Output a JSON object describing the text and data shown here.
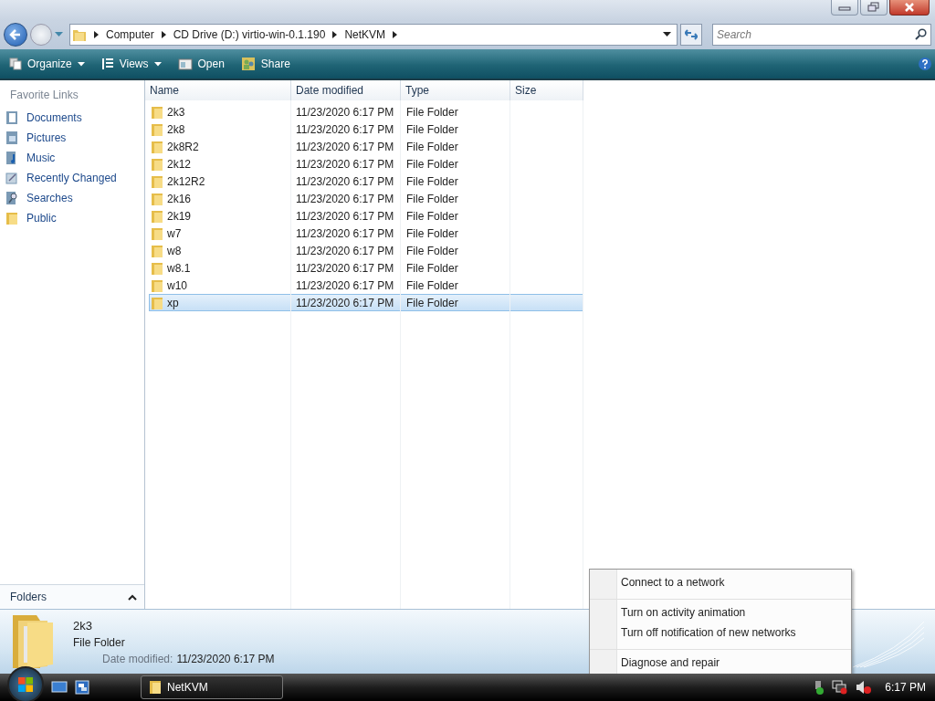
{
  "address": {
    "path": [
      "Computer",
      "CD Drive (D:) virtio-win-0.1.190",
      "NetKVM"
    ]
  },
  "search": {
    "placeholder": "Search"
  },
  "toolbar": [
    {
      "label": "Organize",
      "kind": "organize"
    },
    {
      "label": "Views",
      "kind": "views"
    },
    {
      "label": "Open",
      "kind": "open"
    },
    {
      "label": "Share",
      "kind": "share"
    }
  ],
  "sidebar": {
    "heading": "Favorite Links",
    "items": [
      {
        "label": "Documents",
        "kind": "document"
      },
      {
        "label": "Pictures",
        "kind": "picture"
      },
      {
        "label": "Music",
        "kind": "music"
      },
      {
        "label": "Recently Changed",
        "kind": "recent"
      },
      {
        "label": "Searches",
        "kind": "search"
      },
      {
        "label": "Public",
        "kind": "folder"
      }
    ],
    "folders_label": "Folders"
  },
  "table": {
    "columns": [
      "Name",
      "Date modified",
      "Type",
      "Size"
    ],
    "rows": [
      {
        "name": "2k3",
        "date": "11/23/2020 6:17 PM",
        "type": "File Folder",
        "selected": false
      },
      {
        "name": "2k8",
        "date": "11/23/2020 6:17 PM",
        "type": "File Folder",
        "selected": false
      },
      {
        "name": "2k8R2",
        "date": "11/23/2020 6:17 PM",
        "type": "File Folder",
        "selected": false
      },
      {
        "name": "2k12",
        "date": "11/23/2020 6:17 PM",
        "type": "File Folder",
        "selected": false
      },
      {
        "name": "2k12R2",
        "date": "11/23/2020 6:17 PM",
        "type": "File Folder",
        "selected": false
      },
      {
        "name": "2k16",
        "date": "11/23/2020 6:17 PM",
        "type": "File Folder",
        "selected": false
      },
      {
        "name": "2k19",
        "date": "11/23/2020 6:17 PM",
        "type": "File Folder",
        "selected": false
      },
      {
        "name": "w7",
        "date": "11/23/2020 6:17 PM",
        "type": "File Folder",
        "selected": false
      },
      {
        "name": "w8",
        "date": "11/23/2020 6:17 PM",
        "type": "File Folder",
        "selected": false
      },
      {
        "name": "w8.1",
        "date": "11/23/2020 6:17 PM",
        "type": "File Folder",
        "selected": false
      },
      {
        "name": "w10",
        "date": "11/23/2020 6:17 PM",
        "type": "File Folder",
        "selected": false
      },
      {
        "name": "xp",
        "date": "11/23/2020 6:17 PM",
        "type": "File Folder",
        "selected": true
      }
    ]
  },
  "details": {
    "name": "2k3",
    "type": "File Folder",
    "date_label": "Date modified:",
    "date": "11/23/2020 6:17 PM"
  },
  "context_menu": {
    "items": [
      {
        "label": "Connect to a network",
        "separator_before": false
      },
      {
        "label": "Turn on activity animation",
        "separator_before": true
      },
      {
        "label": "Turn off notification of new networks",
        "separator_before": false
      },
      {
        "label": "Diagnose and repair",
        "separator_before": true
      }
    ]
  },
  "taskbar": {
    "windows": [
      {
        "label": "NetKVM"
      }
    ],
    "clock": "6:17 PM"
  }
}
